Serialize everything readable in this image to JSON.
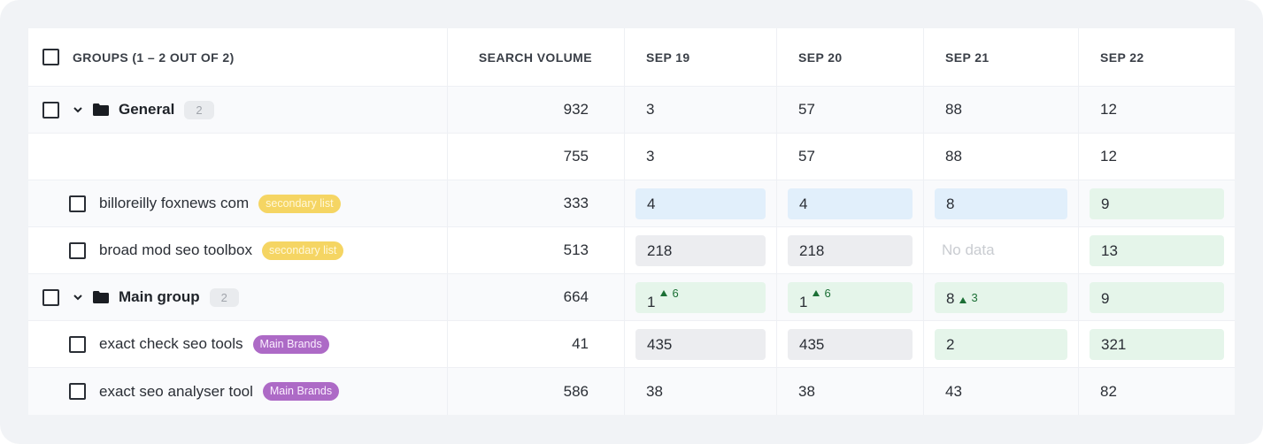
{
  "header": {
    "groups_label": "GROUPS (1 – 2 OUT OF 2)",
    "search_volume_label": "SEARCH VOLUME",
    "dates": [
      "SEP 19",
      "SEP 20",
      "SEP 21",
      "SEP 22"
    ]
  },
  "rows": [
    {
      "type": "group",
      "name": "General",
      "count": "2",
      "search_volume": "932",
      "values": [
        {
          "value": "3",
          "style": "plain"
        },
        {
          "value": "57",
          "style": "plain"
        },
        {
          "value": "88",
          "style": "plain"
        },
        {
          "value": "12",
          "style": "plain"
        }
      ]
    },
    {
      "type": "subtotal",
      "search_volume": "755",
      "values": [
        {
          "value": "3",
          "style": "plain"
        },
        {
          "value": "57",
          "style": "plain"
        },
        {
          "value": "88",
          "style": "plain"
        },
        {
          "value": "12",
          "style": "plain"
        }
      ]
    },
    {
      "type": "item",
      "name": "billoreilly foxnews com",
      "tag": "secondary list",
      "tag_color": "#f5d563",
      "search_volume": "333",
      "values": [
        {
          "value": "4",
          "style": "blue"
        },
        {
          "value": "4",
          "style": "blue"
        },
        {
          "value": "8",
          "style": "blue"
        },
        {
          "value": "9",
          "style": "green"
        }
      ]
    },
    {
      "type": "item",
      "name": "broad mod seo toolbox",
      "tag": "secondary list",
      "tag_color": "#f5d563",
      "search_volume": "513",
      "values": [
        {
          "value": "218",
          "style": "gray"
        },
        {
          "value": "218",
          "style": "gray"
        },
        {
          "value": "No data",
          "style": "nodata"
        },
        {
          "value": "13",
          "style": "green"
        }
      ]
    },
    {
      "type": "group",
      "name": "Main group",
      "count": "2",
      "search_volume": "664",
      "values": [
        {
          "value": "1",
          "delta": "6",
          "style": "green"
        },
        {
          "value": "1",
          "delta": "6",
          "style": "green"
        },
        {
          "value": "8",
          "delta": "3",
          "style": "green"
        },
        {
          "value": "9",
          "style": "green"
        }
      ]
    },
    {
      "type": "item",
      "name": "exact check seo tools",
      "tag": "Main Brands",
      "tag_color": "#ad6ac6",
      "search_volume": "41",
      "values": [
        {
          "value": "435",
          "style": "gray"
        },
        {
          "value": "435",
          "style": "gray"
        },
        {
          "value": "2",
          "style": "green"
        },
        {
          "value": "321",
          "style": "green"
        }
      ]
    },
    {
      "type": "item",
      "name": "exact seo analyser tool",
      "tag": "Main Brands",
      "tag_color": "#ad6ac6",
      "search_volume": "586",
      "values": [
        {
          "value": "38",
          "style": "plain"
        },
        {
          "value": "38",
          "style": "plain"
        },
        {
          "value": "43",
          "style": "plain"
        },
        {
          "value": "82",
          "style": "plain"
        }
      ]
    }
  ],
  "colors": {
    "blue_cell": "#e1effb",
    "gray_cell": "#ecedf0",
    "green_cell": "#e5f5ea",
    "delta_up": "#1b6f35"
  }
}
